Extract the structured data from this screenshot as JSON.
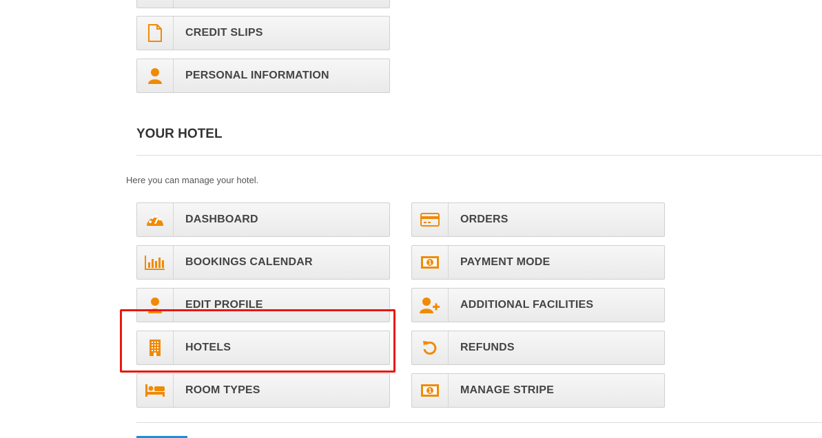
{
  "colors": {
    "accent": "#f08a05",
    "highlight": "#e8170f",
    "link_bar": "#1b8fd8"
  },
  "account_section": {
    "items": [
      {
        "label": "CREDIT SLIPS",
        "icon": "file-icon"
      },
      {
        "label": "PERSONAL INFORMATION",
        "icon": "user-icon"
      }
    ]
  },
  "hotel_section": {
    "title": "YOUR HOTEL",
    "description": "Here you can manage your hotel.",
    "left_items": [
      {
        "label": "DASHBOARD",
        "icon": "gauge-icon"
      },
      {
        "label": "BOOKINGS CALENDAR",
        "icon": "bar-chart-icon"
      },
      {
        "label": "EDIT PROFILE",
        "icon": "user-icon"
      },
      {
        "label": "HOTELS",
        "icon": "building-icon"
      },
      {
        "label": "ROOM TYPES",
        "icon": "bed-icon"
      }
    ],
    "right_items": [
      {
        "label": "ORDERS",
        "icon": "credit-card-icon"
      },
      {
        "label": "PAYMENT MODE",
        "icon": "money-icon"
      },
      {
        "label": "ADDITIONAL FACILITIES",
        "icon": "user-plus-icon"
      },
      {
        "label": "REFUNDS",
        "icon": "undo-icon"
      },
      {
        "label": "MANAGE STRIPE",
        "icon": "money-icon"
      }
    ]
  }
}
